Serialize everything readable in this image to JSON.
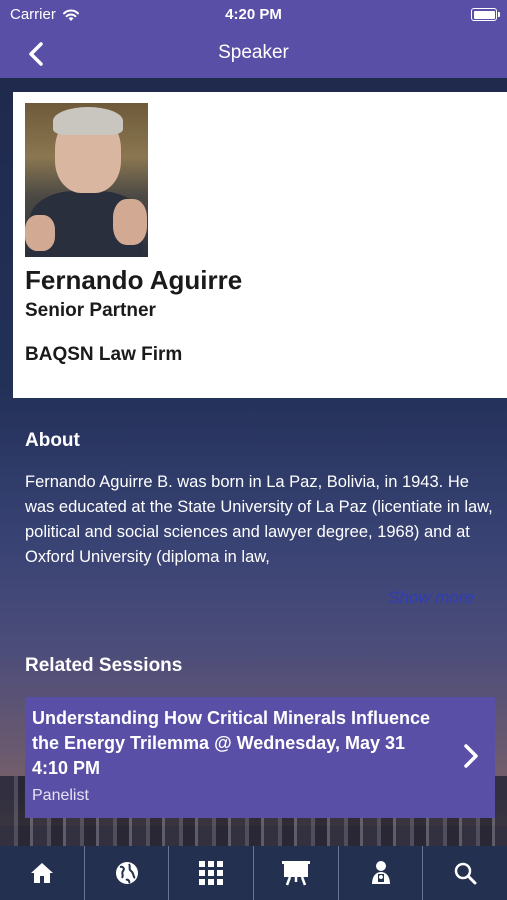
{
  "status_bar": {
    "carrier": "Carrier",
    "time": "4:20 PM",
    "battery_level": 1.0
  },
  "nav": {
    "title": "Speaker"
  },
  "speaker": {
    "name": "Fernando Aguirre",
    "role": "Senior Partner",
    "firm": "BAQSN Law Firm"
  },
  "about": {
    "heading": "About",
    "text": "Fernando Aguirre B. was born in La Paz, Bolivia, in 1943. He was educated at the State University of La Paz (licentiate in law, political and social sciences and lawyer degree, 1968) and at Oxford University (diploma in law,",
    "show_more": "Show more"
  },
  "related": {
    "heading": "Related Sessions",
    "sessions": [
      {
        "title": "Understanding How Critical Minerals Influence the Energy Trilemma @ Wednesday, May 31 4:10 PM",
        "role": "Panelist"
      }
    ]
  },
  "tab_bar": {
    "tabs": [
      "home-icon",
      "globe-icon",
      "grid-icon",
      "presentation-icon",
      "speaker-icon",
      "search-icon"
    ]
  },
  "colors": {
    "brand_purple": "#5a4fa6",
    "tab_bar": "#23304f",
    "link": "#2f3db8"
  }
}
